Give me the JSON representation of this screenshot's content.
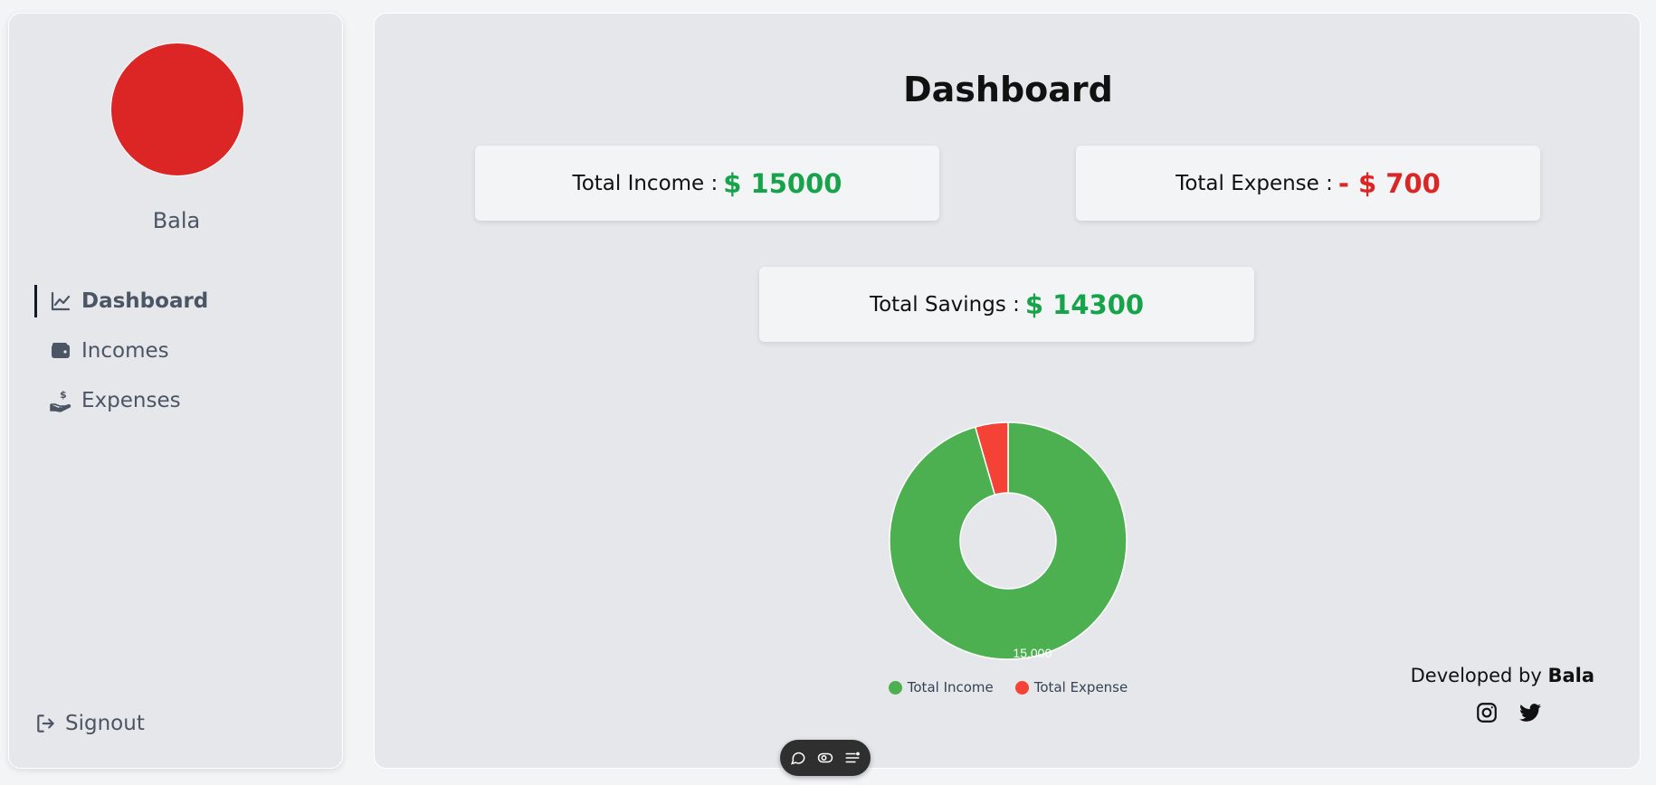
{
  "sidebar": {
    "user_name": "Bala",
    "avatar_color": "#dc2626",
    "nav": [
      {
        "label": "Dashboard",
        "icon": "chart-line-icon",
        "active": true
      },
      {
        "label": "Incomes",
        "icon": "wallet-icon",
        "active": false
      },
      {
        "label": "Expenses",
        "icon": "hand-dollar-icon",
        "active": false
      }
    ],
    "signout_label": "Signout"
  },
  "main": {
    "title": "Dashboard",
    "cards": {
      "income": {
        "label": "Total Income :",
        "value": "$ 15000"
      },
      "expense": {
        "label": "Total Expense :",
        "value": "- $ 700"
      },
      "savings": {
        "label": "Total Savings :",
        "value": "$ 14300"
      }
    },
    "footer": {
      "credit_prefix": "Developed by",
      "credit_name": "Bala",
      "social_icons": [
        "instagram-icon",
        "twitter-icon"
      ]
    }
  },
  "colors": {
    "positive": "#16a34a",
    "negative": "#dc2626",
    "income_slice": "#4caf50",
    "expense_slice": "#f44336"
  },
  "chart_data": {
    "type": "pie",
    "labels": [
      "Total Income",
      "Total Expense"
    ],
    "values": [
      15000,
      700
    ],
    "colors": [
      "#4caf50",
      "#f44336"
    ],
    "data_labels": [
      "15,000",
      ""
    ],
    "legend": "bottom"
  },
  "toolbar_icons": [
    "comment-icon",
    "toggle-icon",
    "menu-list-icon"
  ]
}
